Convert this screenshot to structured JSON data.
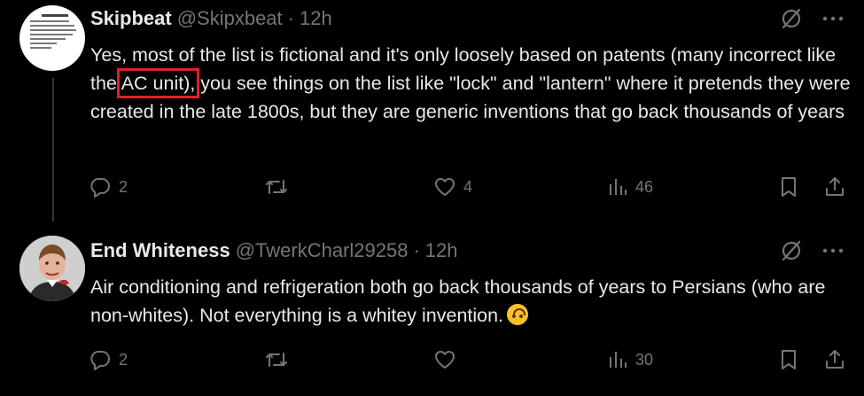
{
  "tweets": [
    {
      "name": "Skipbeat",
      "handle": "@Skipxbeat",
      "time": "12h",
      "text_before": "Yes, most of the list is fictional and it's only loosely based on patents (many incorrect like the ",
      "text_highlight": "AC unit),",
      "text_after": " you see things on the list like \"lock\" and \"lantern\" where it pretends they were created in the late 1800s, but they are generic inventions that go back thousands of years",
      "replies": "2",
      "retweets": "",
      "likes": "4",
      "views": "46"
    },
    {
      "name": "End Whiteness",
      "handle": "@TwerkCharl29258",
      "time": "12h",
      "text": "Air conditioning and refrigeration both go back thousands of years to Persians (who are non-whites). Not everything is a whitey invention.",
      "emoji": "upside-down-face",
      "replies": "2",
      "retweets": "",
      "likes": "",
      "views": "30"
    }
  ],
  "icons": {
    "grok": "grok-slash-icon",
    "more": "more-dots-icon",
    "reply": "reply-bubble-icon",
    "retweet": "retweet-icon",
    "like": "heart-icon",
    "views": "analytics-bars-icon",
    "bookmark": "bookmark-icon",
    "share": "share-icon"
  },
  "colors": {
    "background": "#000000",
    "text": "#e7e9ea",
    "muted": "#71767b",
    "highlight_box": "#e0202a",
    "divider": "#333639"
  }
}
